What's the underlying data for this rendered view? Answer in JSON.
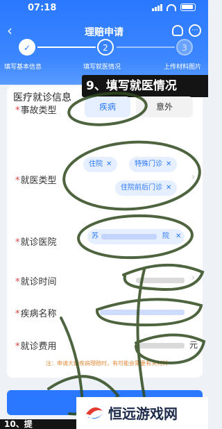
{
  "status_bar": {
    "time": "07:18"
  },
  "nav": {
    "back_icon": "‹",
    "title": "理赔申请",
    "more_icon": "⋯"
  },
  "steps": [
    {
      "number": "✓",
      "label": "填写基本信息"
    },
    {
      "number": "2",
      "label": "填写就医情况"
    },
    {
      "number": "3",
      "label": "上传材料图片"
    }
  ],
  "overlay_banner": "9、填写就医情况",
  "section_title": "医疗就诊信息",
  "fields": {
    "accident_type": {
      "label": "事故类型",
      "options": [
        "疾病",
        "意外"
      ],
      "selected": "疾病"
    },
    "medical_type": {
      "label": "就医类型",
      "tags": [
        "住院",
        "特殊门诊",
        "住院前后门诊"
      ]
    },
    "hospital": {
      "label": "就诊医院",
      "value_prefix": "苏",
      "value_suffix": "院"
    },
    "visit_time": {
      "label": "就诊时间"
    },
    "disease_name": {
      "label": "疾病名称"
    },
    "medical_cost": {
      "label": "就诊费用",
      "unit": "元"
    }
  },
  "tag_close_icon": "✕",
  "chevron_icon": "›",
  "footnote": "注：申请大额疾病理赔时，有可能会需要有关材料",
  "logo_text": "恒远游戏网",
  "cut_banner": "10、提",
  "colors": {
    "primary": "#2a78ff",
    "required": "#e04040",
    "annotation": "#2e4a1e"
  }
}
